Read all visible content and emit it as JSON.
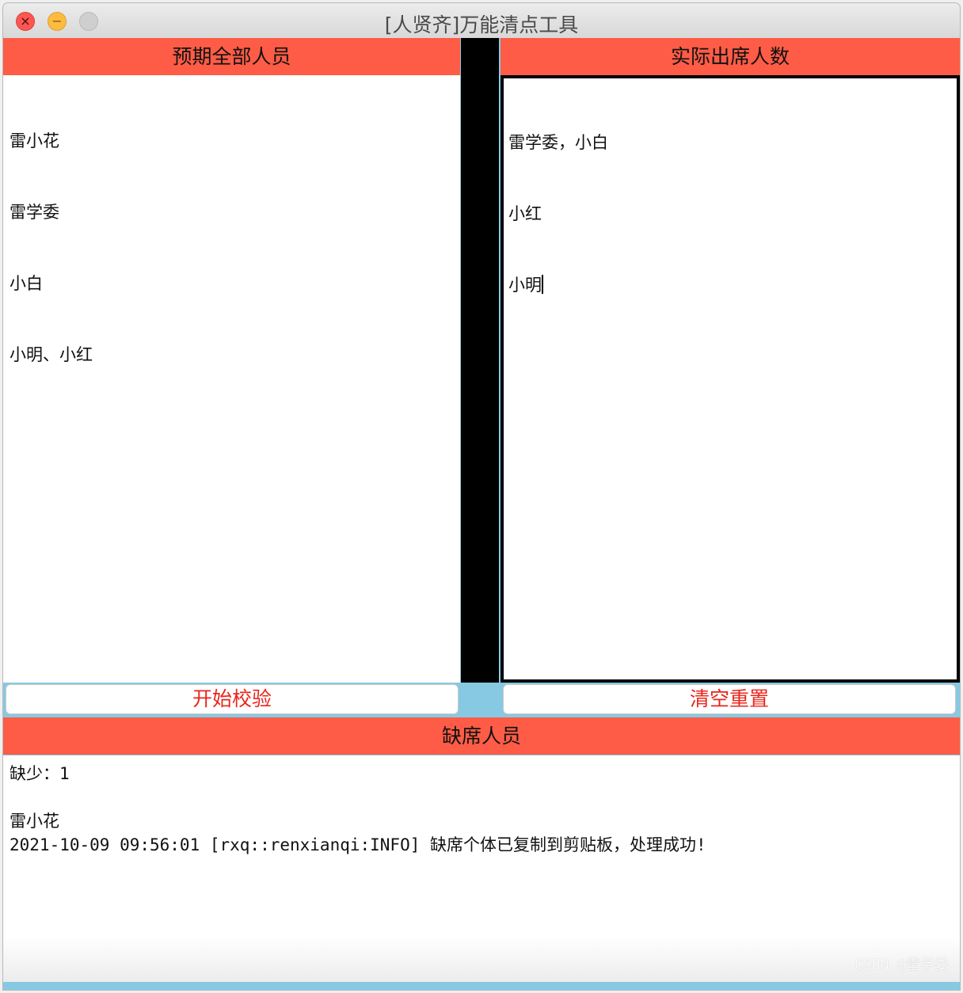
{
  "window": {
    "title": "[人贤齐]万能清点工具",
    "controls": {
      "close": "×",
      "minimize": "−"
    }
  },
  "left_panel": {
    "header": "预期全部人员",
    "lines": [
      "雷小花",
      "雷学委",
      "小白",
      "小明、小红"
    ],
    "button": "开始校验"
  },
  "right_panel": {
    "header": "实际出席人数",
    "lines": [
      "雷学委，小白",
      "小红",
      "小明"
    ],
    "button": "清空重置"
  },
  "result_panel": {
    "header": "缺席人员",
    "lines": [
      "缺少：1",
      "",
      "雷小花",
      "2021-10-09 09:56:01 [rxq::renxianqi:INFO] 缺席个体已复制到剪贴板，处理成功!"
    ]
  },
  "watermark": "CSDN @雷学委",
  "colors": {
    "header": "#fe5c46",
    "button_text": "#e8261c",
    "background": "#87c9e3"
  }
}
